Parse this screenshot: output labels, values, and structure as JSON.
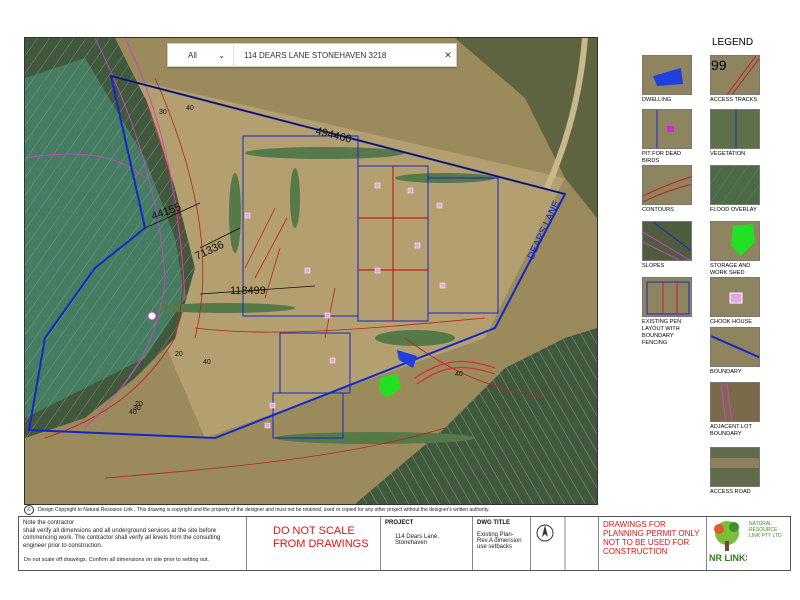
{
  "search": {
    "category": "All",
    "query": "114 DEARS LANE STONEHAVEN 3218",
    "clear_icon": "close-icon",
    "dropdown_icon": "chevron-down-icon"
  },
  "map": {
    "labels": {
      "road": "DEARS LANE",
      "lot_a": "494460",
      "lot_b": "44155",
      "lot_c": "71336",
      "lot_d": "118499"
    },
    "contour_labels": [
      "30",
      "40",
      "20",
      "40",
      "40",
      "20",
      "30",
      "40"
    ]
  },
  "legend": {
    "title": "LEGEND",
    "items": [
      {
        "label": "DWELLING"
      },
      {
        "label": "ACCESS TRACKS",
        "text": "99"
      },
      {
        "label": "PIT FOR DEAD BIRDS"
      },
      {
        "label": "VEGETATION"
      },
      {
        "label": "CONTOURS"
      },
      {
        "label": "FLOOD OVERLAY"
      },
      {
        "label": "SLOPES"
      },
      {
        "label": "STORAGE AND WORK SHED"
      },
      {
        "label": "EXISTING PEN LAYOUT WITH BOUNDARY FENCING"
      },
      {
        "label": "CHOOK HOUSE"
      },
      {
        "label": "BOUNDARY"
      },
      {
        "label": "ADJACENT LOT BOUNDARY"
      },
      {
        "label": "ACCESS ROAD"
      }
    ]
  },
  "copyright": "Design Copyright to Natural Resource Link , This drawing is copyright and the property of the designer and must not be retained, used or copied for any other project without the designer's written authority.",
  "titleblock": {
    "notes_line1": "Note the contractor",
    "notes_line2": "shall verify all dimensions and all underground services at the site before commencing work. The contractor shall verify all levels from the consulting engineer prior to construction.",
    "notes_line3": "Do not scale off drawings. Confirm all dimensions on site prior to setting out.",
    "do_not_scale": "DO NOT SCALE FROM DRAWINGS",
    "project_hdr": "PROJECT",
    "project": "114 Dears Lane, Stonehaven",
    "dwg_title_hdr": "DWG TITLE",
    "dwg_title": "Existing Plan-Rev.A dimension use setbacks",
    "permit": "DRAWINGS FOR PLANNING PERMIT ONLY NOT TO BE USED FOR CONSTRUCTION",
    "company": "NATURAL RESOURCE LINK PTY LTD",
    "company_short": "NR LINKS"
  },
  "colors": {
    "boundary": "#1428c8",
    "adjacent": "#c845c8",
    "contour": "#c02020",
    "dwelling": "#1f3fe0",
    "shed": "#22e022",
    "permit_red": "#e11111"
  }
}
